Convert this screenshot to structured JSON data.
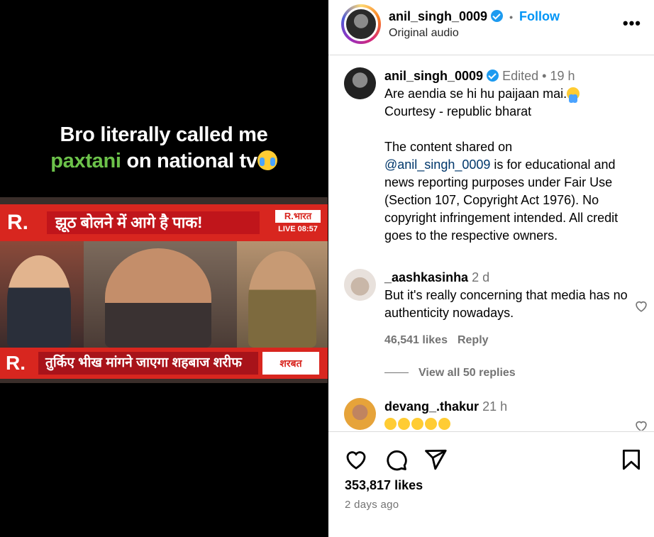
{
  "media": {
    "overlay_line1": "Bro literally called me",
    "overlay_green": "paxtani",
    "overlay_rest": " on national tv",
    "news_logo": "R.",
    "news_headline": "झूठ बोलने में आगे है पाक!",
    "news_channel": "R.भारत",
    "news_live": "LIVE 08:57",
    "news_ticker": "तुर्किए भीख मांगने जाएगा शहबाज शरीफ",
    "news_sponsor": "शरबत"
  },
  "header": {
    "username": "anil_singh_0009",
    "separator": "•",
    "follow_label": "Follow",
    "audio_label": "Original audio",
    "more_label": "•••"
  },
  "caption": {
    "username": "anil_singh_0009",
    "edited": "Edited",
    "separator": "•",
    "time": "19 h",
    "line1": "Are aendia se hi hu paijaan mai.",
    "line2": "Courtesy - republic bharat",
    "para_before": "The content shared on",
    "mention": "@anil_singh_0009",
    "para_after": " is for educational and news reporting purposes under Fair Use (Section 107, Copyright Act 1976). No copyright infringement intended. All credit goes to the respective owners."
  },
  "comments": [
    {
      "username": "_aashkasinha",
      "time": "2 d",
      "text": "But it's really concerning that media has no authenticity nowadays.",
      "likes": "46,541 likes",
      "reply_label": "Reply",
      "view_replies": "View all 50 replies"
    },
    {
      "username": "devang_.thakur",
      "time": "21 h"
    }
  ],
  "footer": {
    "likes_total": "353,817 likes",
    "posted_ago": "2 days ago"
  }
}
